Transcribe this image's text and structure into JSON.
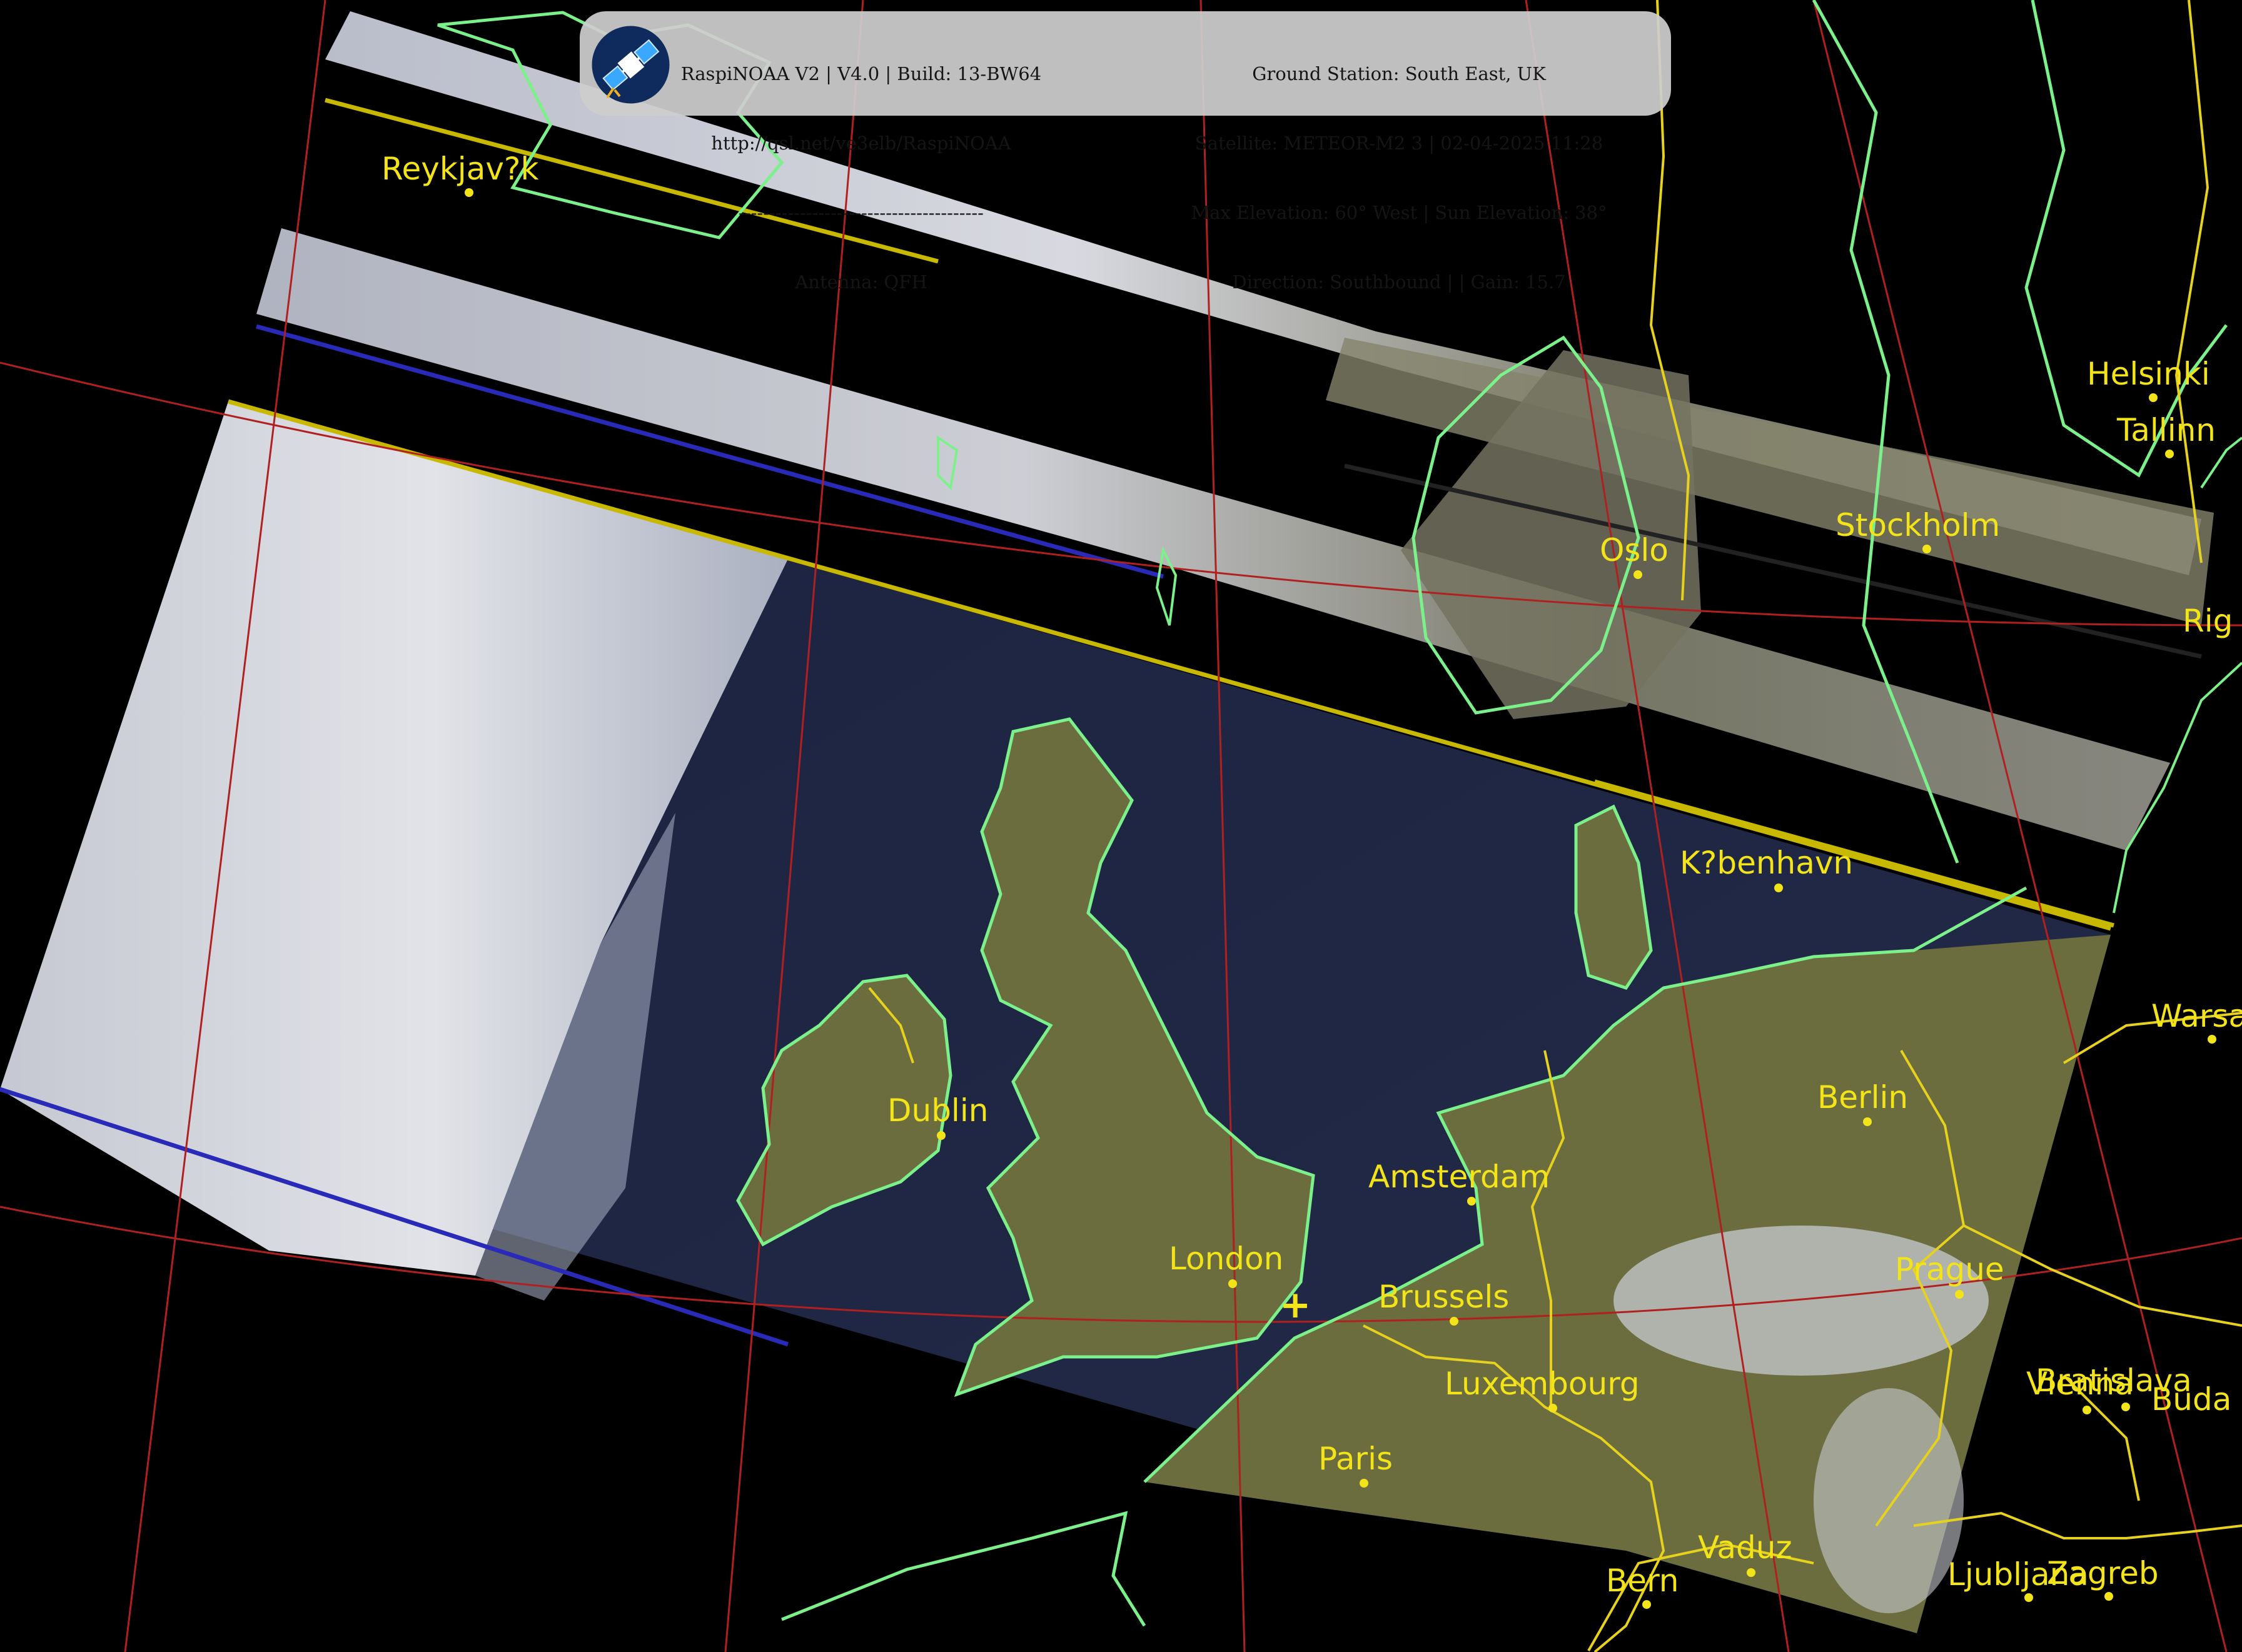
{
  "header": {
    "left_lines": [
      "RaspiNOAA V2 | V4.0 | Build: 13-BW64",
      "http://qsl.net/ve3elb/RaspiNOAA",
      "----------------------------------------",
      "Antenna: QFH"
    ],
    "right_lines": [
      "Ground Station: South East, UK",
      "Satellite: METEOR-M2 3 | 02-04-2025 11:28",
      "Max Elevation: 60° West | Sun Elevation: 38°",
      "Direction: Southbound | | Gain: 15.7"
    ],
    "logo_icon": "satellite-icon"
  },
  "cities": [
    {
      "name": "Reykjav?k"
    },
    {
      "name": "Oslo"
    },
    {
      "name": "Stockholm"
    },
    {
      "name": "Helsinki"
    },
    {
      "name": "Tallinn"
    },
    {
      "name": "Rig"
    },
    {
      "name": "K?benhavn"
    },
    {
      "name": "Warsa"
    },
    {
      "name": "Dublin"
    },
    {
      "name": "Berlin"
    },
    {
      "name": "Amsterdam"
    },
    {
      "name": "London"
    },
    {
      "name": "Brussels"
    },
    {
      "name": "Prague"
    },
    {
      "name": "Luxembourg"
    },
    {
      "name": "Vienna"
    },
    {
      "name": "Bratislava"
    },
    {
      "name": "Buda"
    },
    {
      "name": "Paris"
    },
    {
      "name": "Vaduz"
    },
    {
      "name": "Bern"
    },
    {
      "name": "Ljubljana"
    },
    {
      "name": "Zagreb"
    }
  ],
  "colors": {
    "city_label": "#f3e41a",
    "coastline": "#7cf08a",
    "border": "#e6d21e",
    "graticule": "#b02020",
    "background": "#000000"
  },
  "ground_station_marker": "+"
}
